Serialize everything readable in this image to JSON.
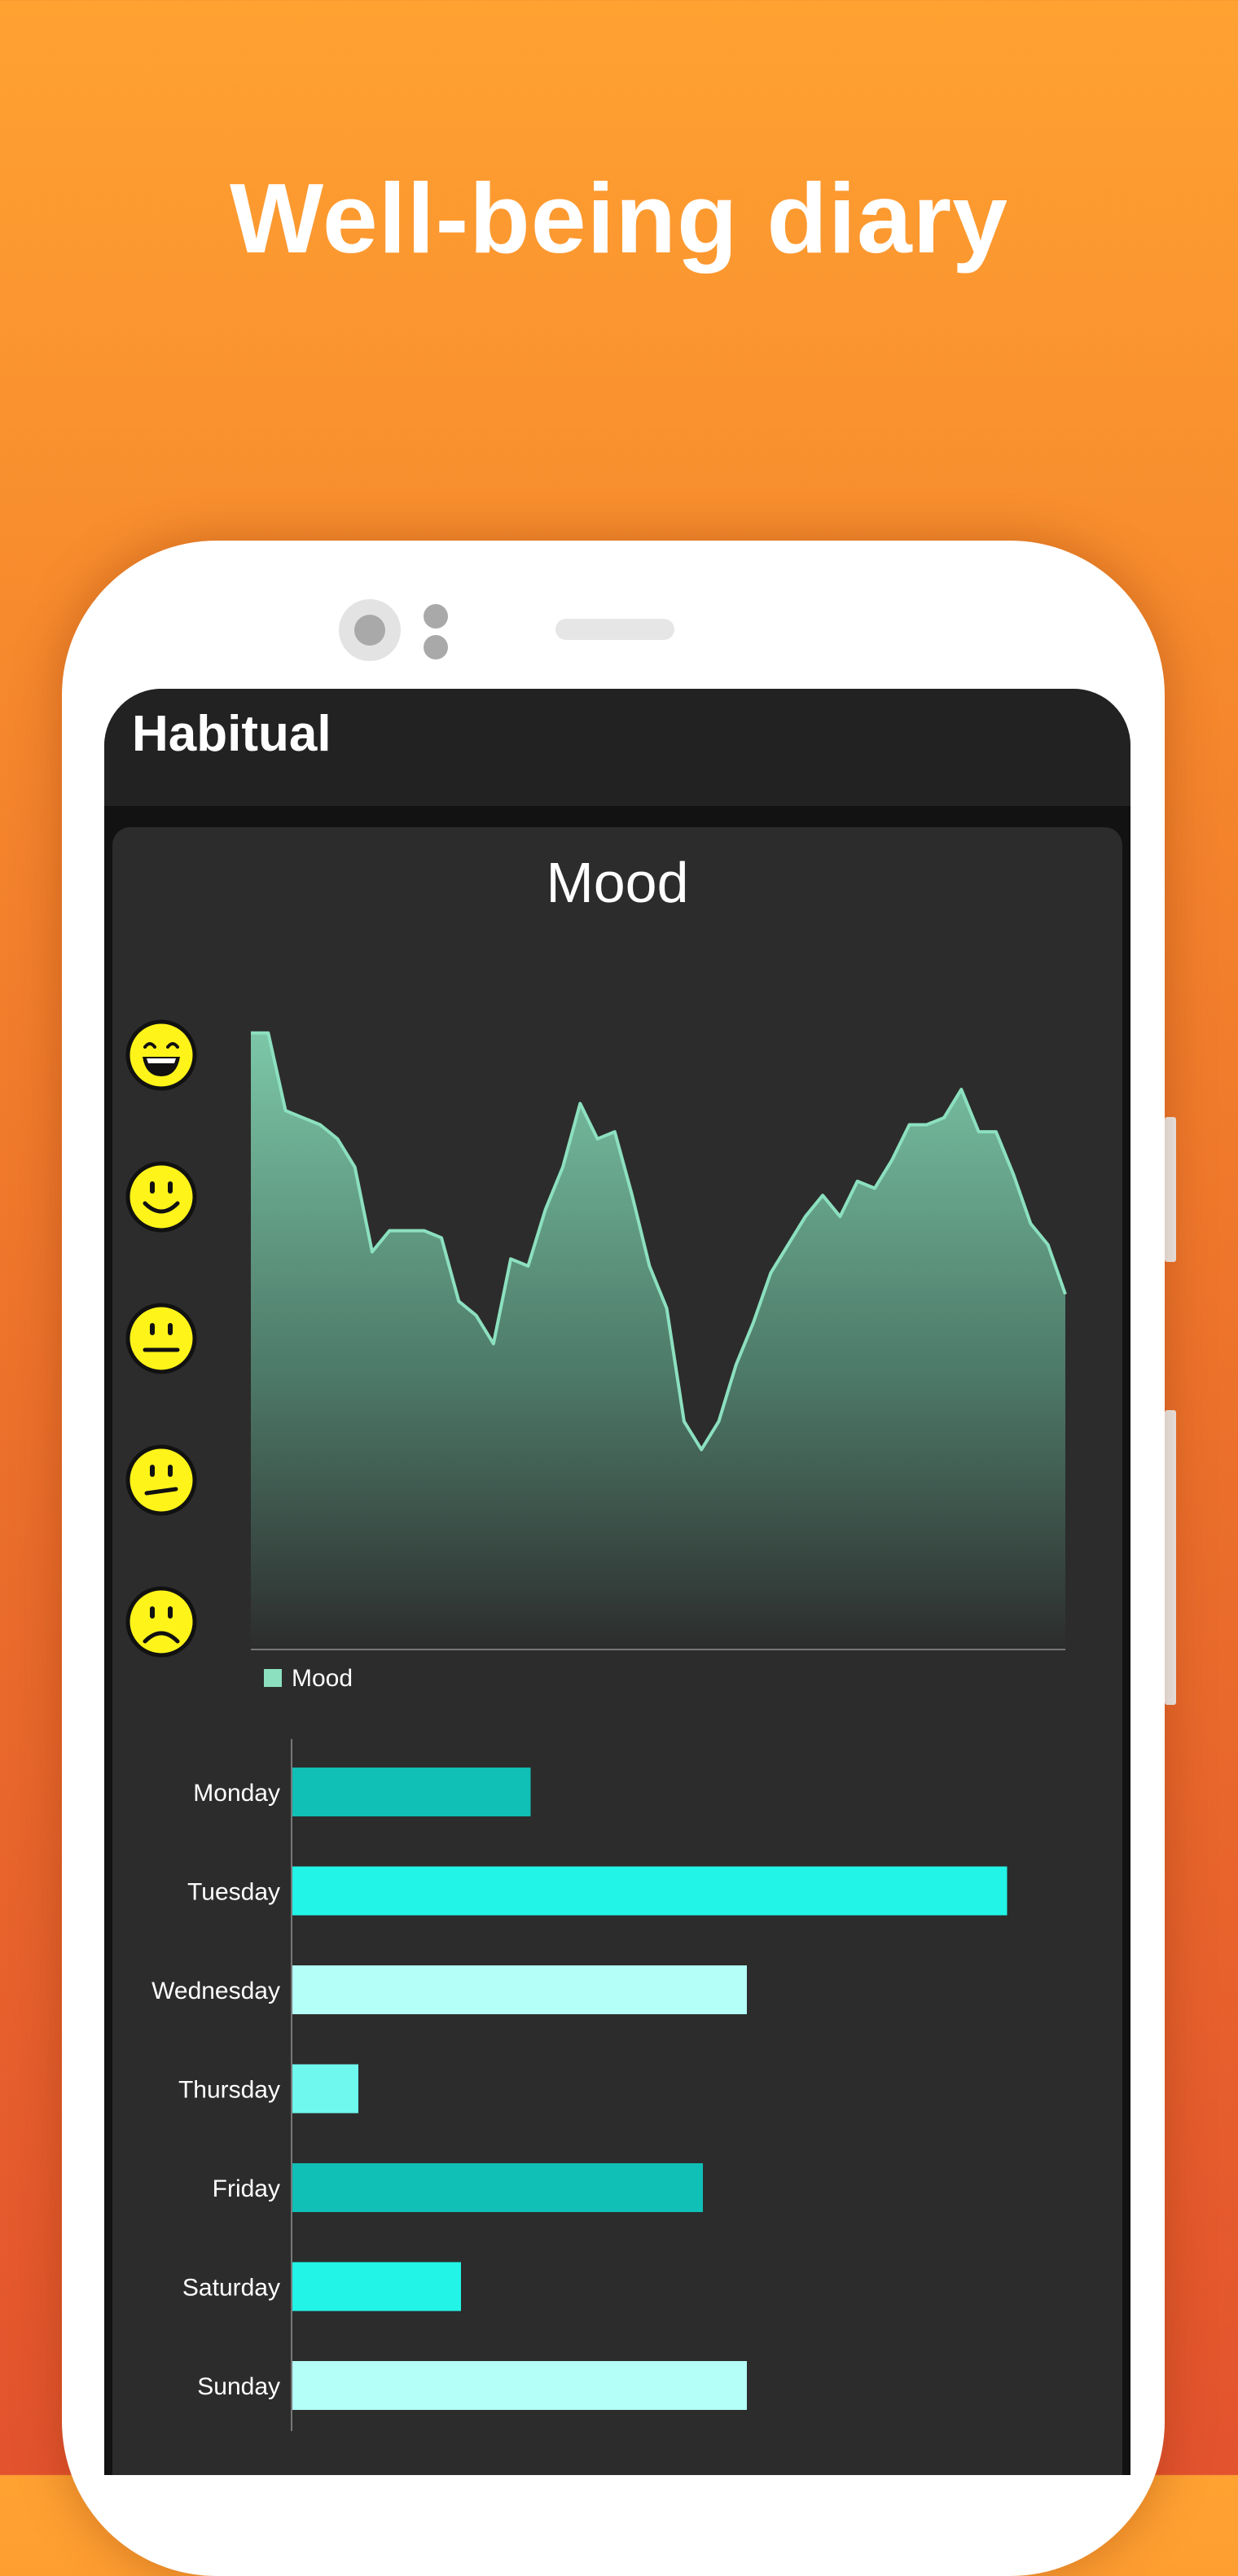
{
  "headline": "Well-being diary",
  "app": {
    "title": "Habitual"
  },
  "card": {
    "title": "Mood"
  },
  "mood_scale_icons": [
    "big-grin-face-icon",
    "smiling-face-icon",
    "neutral-face-icon",
    "unsure-face-icon",
    "sad-face-icon"
  ],
  "colors": {
    "background_top": "#FFA232",
    "background_bottom": "#E3532E",
    "screen": "#121212",
    "card": "#2C2C2C",
    "mood_line": "#8CE0C0",
    "bar_teal": "#10BFB5",
    "bar_cyan": "#22F5E8",
    "bar_light": "#B4FFF7",
    "bar_mid": "#6FF8EE",
    "face_yellow": "#FFF419"
  },
  "chart_data": [
    {
      "type": "area",
      "legend": [
        "Mood"
      ],
      "legend_position": "bottom-left",
      "y_scale_icons": [
        "big-grin",
        "smile",
        "neutral",
        "unsure",
        "sad"
      ],
      "ylim": [
        1,
        5
      ],
      "grid": false,
      "series": [
        {
          "name": "Mood",
          "values": [
            4.95,
            4.95,
            4.4,
            4.35,
            4.3,
            4.2,
            4.0,
            3.4,
            3.55,
            3.55,
            3.55,
            3.5,
            3.05,
            2.95,
            2.75,
            3.35,
            3.3,
            3.7,
            4.0,
            4.45,
            4.2,
            4.25,
            3.8,
            3.3,
            3.0,
            2.2,
            2.0,
            2.2,
            2.6,
            2.9,
            3.25,
            3.45,
            3.65,
            3.8,
            3.65,
            3.9,
            3.85,
            4.05,
            4.3,
            4.3,
            4.35,
            4.55,
            4.25,
            4.25,
            3.95,
            3.6,
            3.45,
            3.1
          ]
        }
      ]
    },
    {
      "type": "bar",
      "orientation": "horizontal",
      "categories": [
        "Monday",
        "Tuesday",
        "Wednesday",
        "Thursday",
        "Friday",
        "Saturday",
        "Sunday"
      ],
      "values": [
        32.5,
        97.5,
        62,
        9,
        56,
        23,
        62
      ],
      "xlim": [
        0,
        100
      ],
      "grid": false,
      "bar_colors": [
        "#10BFB5",
        "#22F5E8",
        "#B4FFF7",
        "#6FF8EE",
        "#10BFB5",
        "#22F5E8",
        "#B4FFF7"
      ]
    }
  ]
}
